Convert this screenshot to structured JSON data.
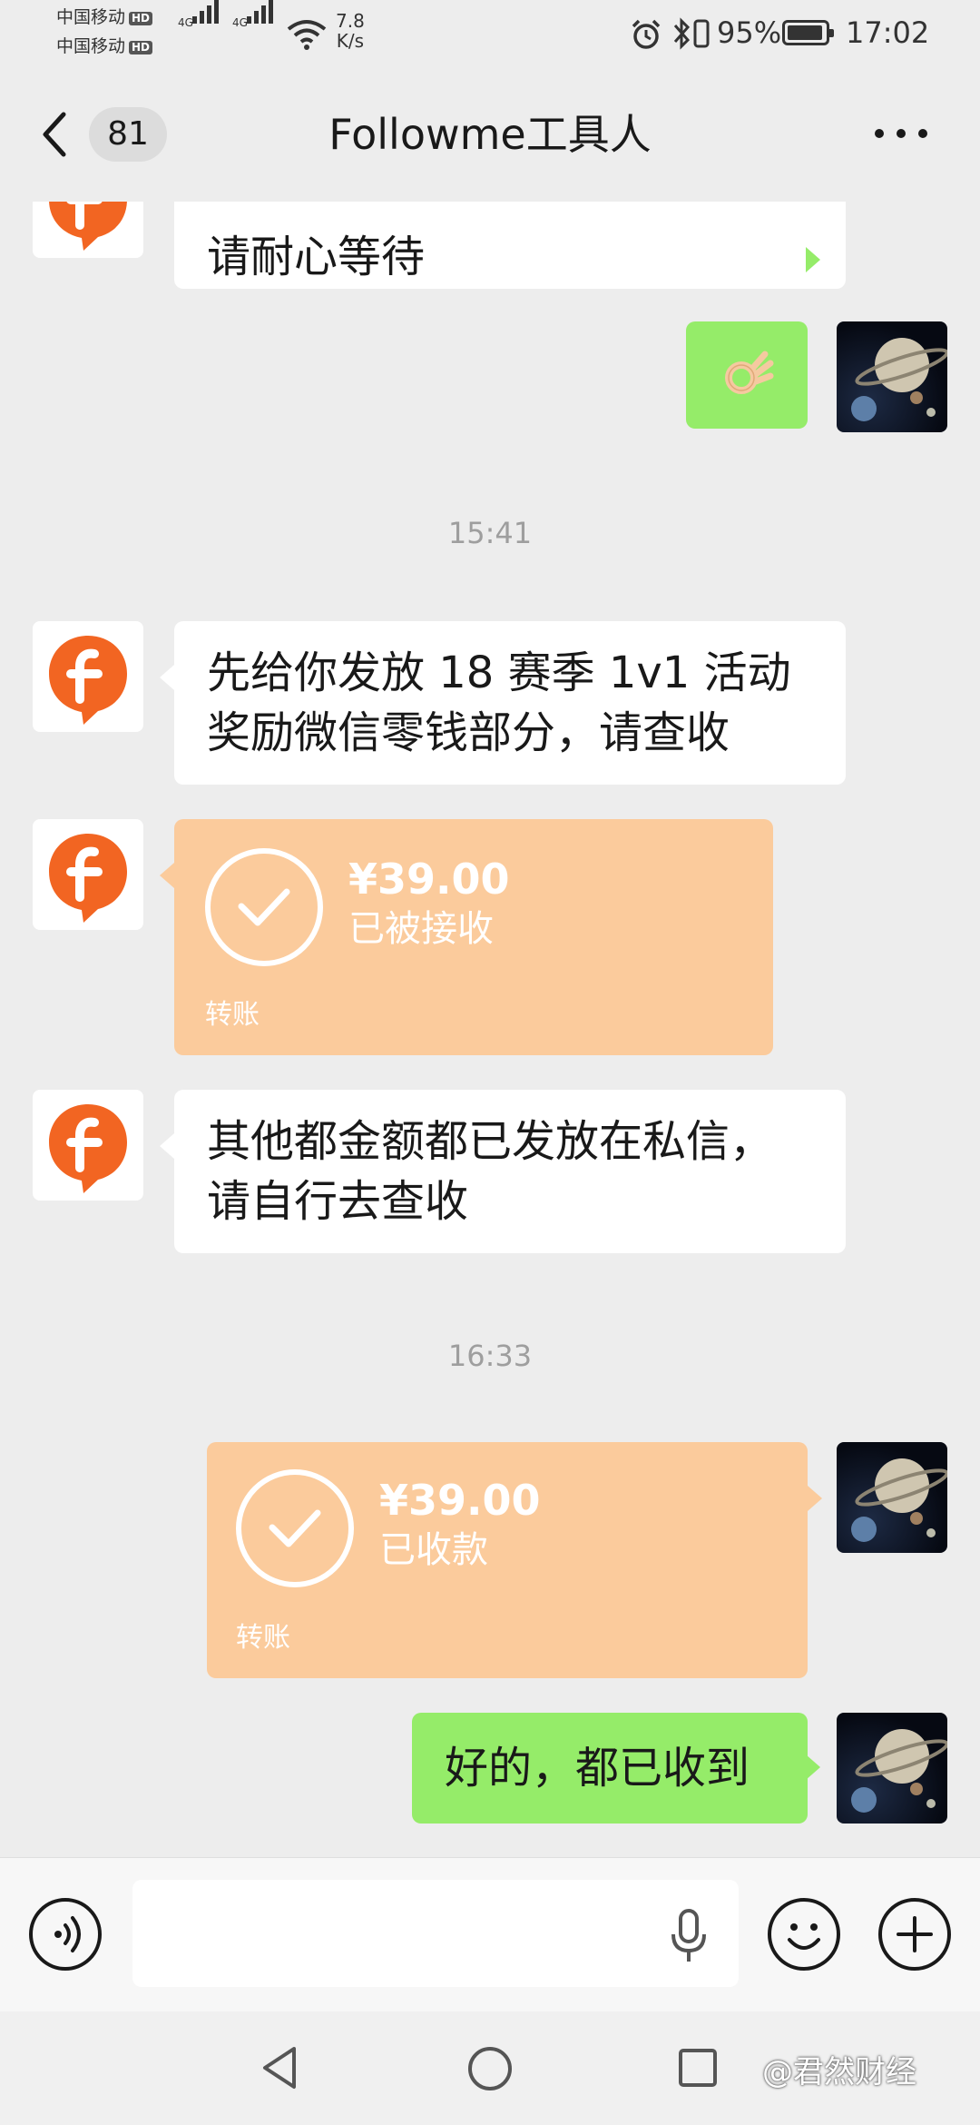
{
  "status_bar": {
    "carrier_1": "中国移动",
    "carrier_2": "中国移动",
    "hd_label": "HD",
    "network_1": "4G",
    "network_2": "4G",
    "speed_value": "7.8",
    "speed_unit": "K/s",
    "battery_percent": "95%",
    "time": "17:02"
  },
  "header": {
    "unread_count": "81",
    "title": "Followme工具人"
  },
  "messages": [
    {
      "type": "text",
      "from": "other",
      "text": "请耐心等待"
    },
    {
      "type": "emoji",
      "from": "self",
      "text": "👌"
    },
    {
      "type": "timestamp",
      "text": "15:41"
    },
    {
      "type": "text",
      "from": "other",
      "lines": [
        "先给你发放 18 赛季 1v1 活动",
        "奖励微信零钱部分，请查收"
      ]
    },
    {
      "type": "transfer",
      "from": "other",
      "amount": "¥39.00",
      "status": "已被接收",
      "label": "转账"
    },
    {
      "type": "text",
      "from": "other",
      "lines": [
        "其他都金额都已发放在私信，",
        "请自行去查收"
      ]
    },
    {
      "type": "timestamp",
      "text": "16:33"
    },
    {
      "type": "transfer",
      "from": "self",
      "amount": "¥39.00",
      "status": "已收款",
      "label": "转账"
    },
    {
      "type": "text",
      "from": "self",
      "text": "好的，都已收到"
    }
  ],
  "input_bar": {
    "voice_icon": "voice-icon",
    "mic_icon": "microphone-icon",
    "emoji_icon": "emoji-icon",
    "plus_icon": "plus-icon"
  },
  "watermark": "@君然财经",
  "colors": {
    "background": "#ededed",
    "self_bubble": "#95ec69",
    "transfer_bubble": "#fbcb9c",
    "brand_orange": "#f26522"
  }
}
